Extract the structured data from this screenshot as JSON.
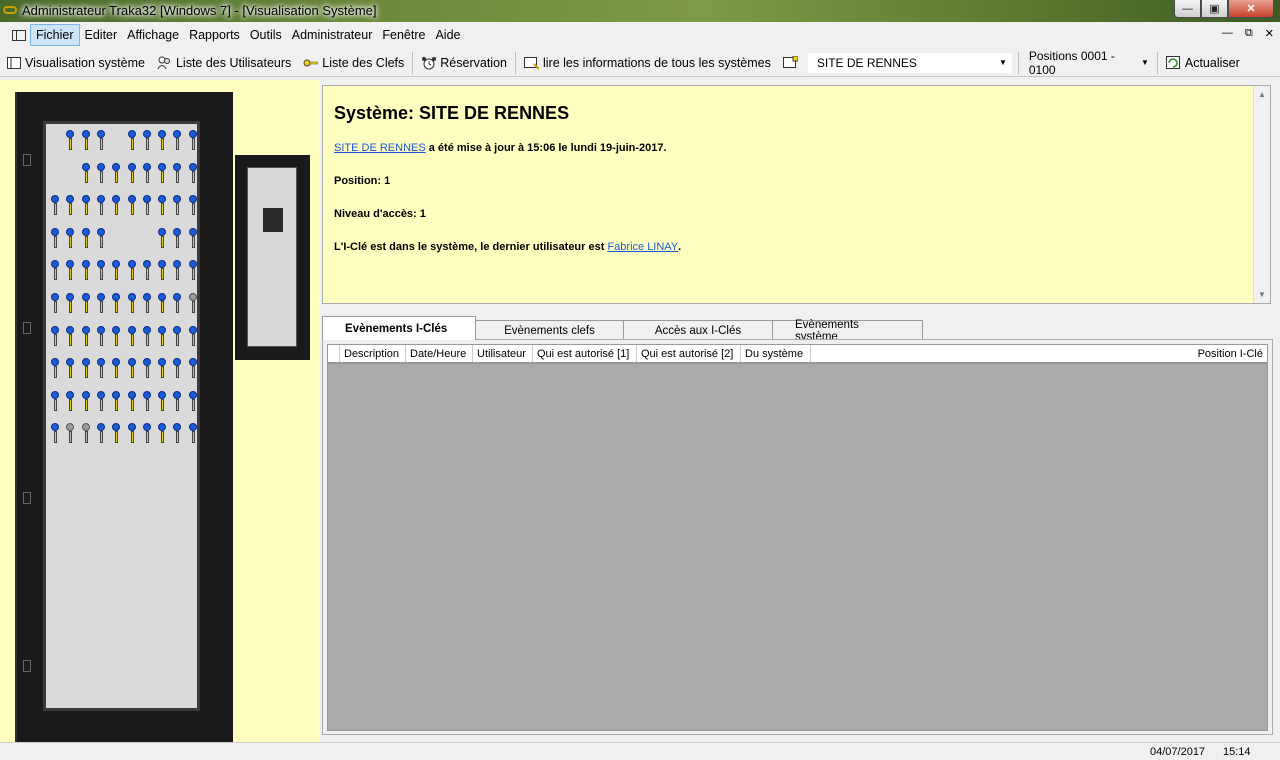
{
  "window": {
    "title": "Administrateur Traka32  [Windows 7] - [Visualisation Système]",
    "min_btn": "—",
    "max_btn": "▣",
    "close_btn": "✕"
  },
  "menu": {
    "items": [
      "Fichier",
      "Editer",
      "Affichage",
      "Rapports",
      "Outils",
      "Administrateur",
      "Fenêtre",
      "Aide"
    ],
    "mdi_controls": [
      "—",
      "⧉",
      "✕"
    ]
  },
  "toolbar": {
    "visualisation": "Visualisation système",
    "utilisateurs": "Liste des Utilisateurs",
    "clefs": "Liste des Clefs",
    "reservation": "Réservation",
    "lire_info": "lire les informations de tous les systèmes",
    "site_combo": "SITE DE RENNES",
    "positions_combo": "Positions 0001 - 0100",
    "actualiser": "Actualiser"
  },
  "info": {
    "title": "Système: SITE DE RENNES",
    "line1_link": "SITE DE RENNES",
    "line1_text": " a été mise à jour à 15:06 le lundi 19-juin-2017.",
    "position": "Position: 1",
    "niveau": "Niveau d'accès: 1",
    "line4_text": "L'I-Clé est dans le système, le dernier utilisateur est ",
    "line4_link": "Fabrice LINAY",
    "line4_end": "."
  },
  "tabs": [
    "Evènements I-Clés",
    "Evènements clefs",
    "Accès aux I-Clés",
    "Evènements système"
  ],
  "grid": {
    "columns": [
      "Description",
      "Date/Heure",
      "Utilisateur",
      "Qui est autorisé [1]",
      "Qui est autorisé [2]",
      "Du système",
      "Position I-Clé"
    ]
  },
  "cabinet": {
    "key_grid_missing": [
      [
        0,
        0
      ],
      [
        0,
        4
      ],
      [
        1,
        0
      ],
      [
        1,
        1
      ],
      [
        3,
        4
      ],
      [
        3,
        5
      ],
      [
        3,
        6
      ]
    ],
    "key_grid_grey": [
      [
        5,
        9
      ],
      [
        9,
        1
      ],
      [
        9,
        2
      ]
    ]
  },
  "status": {
    "date": "04/07/2017",
    "time": "15:14"
  }
}
